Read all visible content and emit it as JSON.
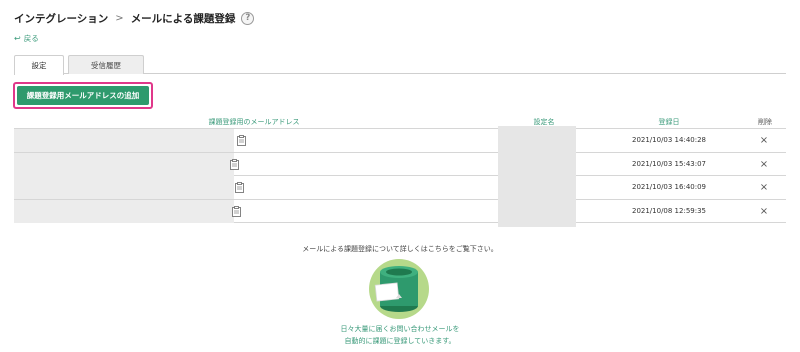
{
  "breadcrumb": {
    "parent": "インテグレーション",
    "separator": ">",
    "current": "メールによる課題登録",
    "help_glyph": "?"
  },
  "back": {
    "icon": "↩",
    "label": "戻る"
  },
  "tabs": [
    {
      "label": "設定",
      "active": true
    },
    {
      "label": "受信履歴",
      "active": false
    }
  ],
  "add_button": {
    "label": "課題登録用メールアドレスの追加"
  },
  "table": {
    "headers": {
      "email": "課題登録用のメールアドレス",
      "name": "設定名",
      "date": "登録日",
      "delete": "削除"
    },
    "rows": [
      {
        "date": "2021/10/03 14:40:28",
        "delete": "×"
      },
      {
        "date": "2021/10/03 15:43:07",
        "delete": "×"
      },
      {
        "date": "2021/10/03 16:40:09",
        "delete": "×"
      },
      {
        "date": "2021/10/08 12:59:35",
        "delete": "×"
      }
    ]
  },
  "info_text": "メールによる課題登録について詳しくはこちらをご覧下さい。",
  "caption": {
    "line1": "日々大量に届くお問い合わせメールを",
    "line2": "自動的に課題に登録していきます。"
  },
  "colors": {
    "accent": "#2e9a6d",
    "highlight": "#e0388a",
    "link": "#3a9a7a"
  }
}
